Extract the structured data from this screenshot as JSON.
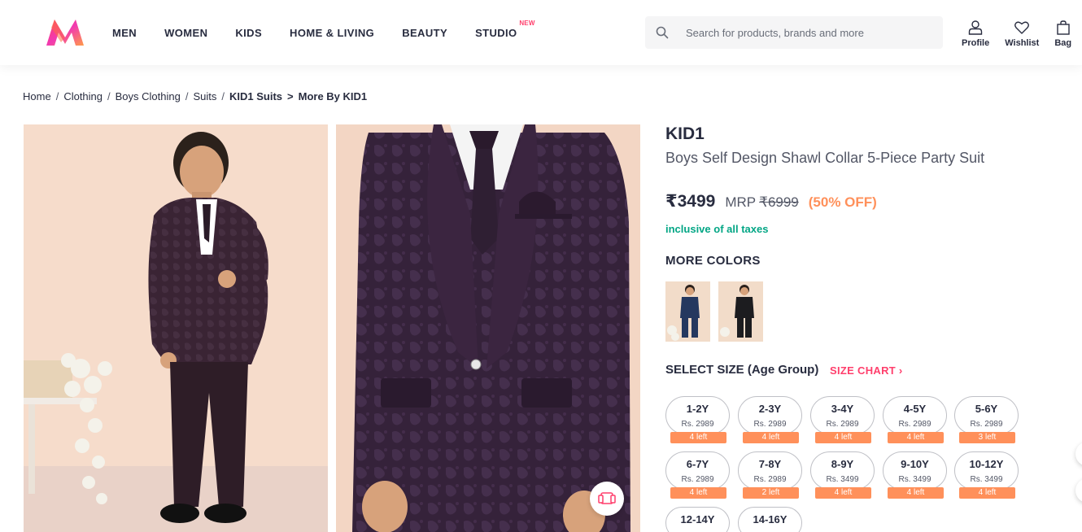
{
  "header": {
    "nav": [
      {
        "label": "MEN",
        "sup": ""
      },
      {
        "label": "WOMEN",
        "sup": ""
      },
      {
        "label": "KIDS",
        "sup": ""
      },
      {
        "label": "HOME & LIVING",
        "sup": ""
      },
      {
        "label": "BEAUTY",
        "sup": ""
      },
      {
        "label": "STUDIO",
        "sup": "NEW"
      }
    ],
    "search_placeholder": "Search for products, brands and more",
    "actions": {
      "profile": "Profile",
      "wishlist": "Wishlist",
      "bag": "Bag"
    }
  },
  "breadcrumb": {
    "items": [
      "Home",
      "Clothing",
      "Boys Clothing",
      "Suits"
    ],
    "current": "KID1 Suits",
    "arrow": ">",
    "more": "More By KID1"
  },
  "product": {
    "brand": "KID1",
    "name": "Boys Self Design Shawl Collar 5-Piece Party Suit",
    "price": "₹3499",
    "mrp_label": "MRP",
    "mrp": "₹6999",
    "discount": "(50% OFF)",
    "taxes": "inclusive of all taxes"
  },
  "more_colors": {
    "title": "MORE COLORS",
    "swatches": [
      "navy-suit",
      "black-suit"
    ]
  },
  "sizes": {
    "title": "SELECT SIZE (Age Group)",
    "chart_label": "SIZE CHART",
    "options": [
      {
        "label": "1-2Y",
        "price": "Rs. 2989",
        "stock": "4 left"
      },
      {
        "label": "2-3Y",
        "price": "Rs. 2989",
        "stock": "4 left"
      },
      {
        "label": "3-4Y",
        "price": "Rs. 2989",
        "stock": "4 left"
      },
      {
        "label": "4-5Y",
        "price": "Rs. 2989",
        "stock": "4 left"
      },
      {
        "label": "5-6Y",
        "price": "Rs. 2989",
        "stock": "3 left"
      },
      {
        "label": "6-7Y",
        "price": "Rs. 2989",
        "stock": "4 left"
      },
      {
        "label": "7-8Y",
        "price": "Rs. 2989",
        "stock": "2 left"
      },
      {
        "label": "8-9Y",
        "price": "Rs. 3499",
        "stock": "4 left"
      },
      {
        "label": "9-10Y",
        "price": "Rs. 3499",
        "stock": "4 left"
      },
      {
        "label": "10-12Y",
        "price": "Rs. 3499",
        "stock": "4 left"
      },
      {
        "label": "12-14Y",
        "price": "",
        "stock": ""
      },
      {
        "label": "14-16Y",
        "price": "",
        "stock": ""
      }
    ]
  },
  "colors": {
    "accent": "#ff3f6c",
    "discount": "#ff905a",
    "tax": "#03a685",
    "text": "#282c3f"
  }
}
